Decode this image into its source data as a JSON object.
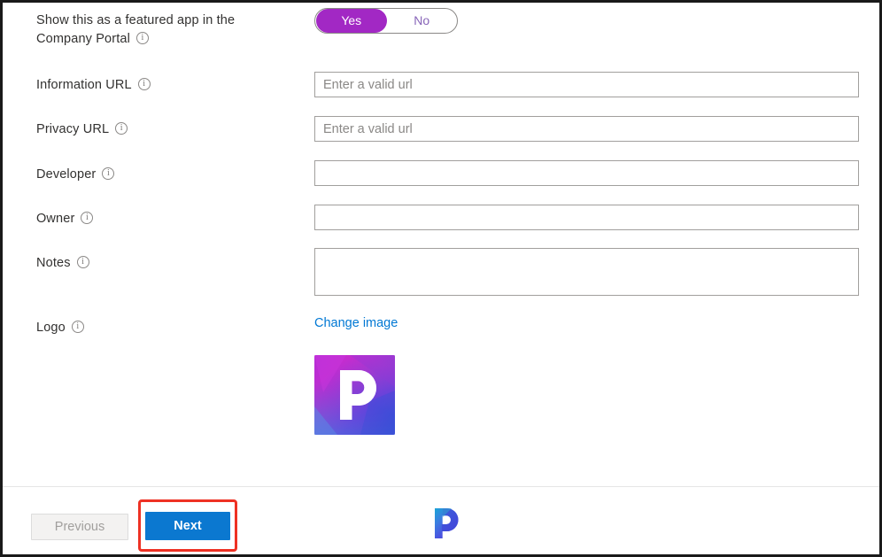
{
  "form": {
    "featured": {
      "label_line1": "Show this as a featured app in the",
      "label_line2": "Company Portal",
      "toggle": {
        "yes_label": "Yes",
        "no_label": "No",
        "selected": "Yes",
        "accent_color": "#a228c4",
        "text_color": "#8764b8"
      }
    },
    "fields": [
      {
        "label": "Information URL",
        "placeholder": "Enter a valid url",
        "value": "",
        "type": "text"
      },
      {
        "label": "Privacy URL",
        "placeholder": "Enter a valid url",
        "value": "",
        "type": "text"
      },
      {
        "label": "Developer",
        "placeholder": "",
        "value": "",
        "type": "text"
      },
      {
        "label": "Owner",
        "placeholder": "",
        "value": "",
        "type": "text"
      },
      {
        "label": "Notes",
        "placeholder": "",
        "value": "",
        "type": "textarea"
      }
    ],
    "logo": {
      "label": "Logo",
      "change_link": "Change image",
      "link_color": "#0078d4",
      "glyph": "P",
      "gradient_from": "#c42bd2",
      "gradient_to": "#2a52d6"
    }
  },
  "footer": {
    "previous_label": "Previous",
    "previous_disabled": true,
    "next_label": "Next",
    "next_color": "#0b78d0",
    "brand_glyph": "P",
    "annotation_color": "#ee3124"
  }
}
